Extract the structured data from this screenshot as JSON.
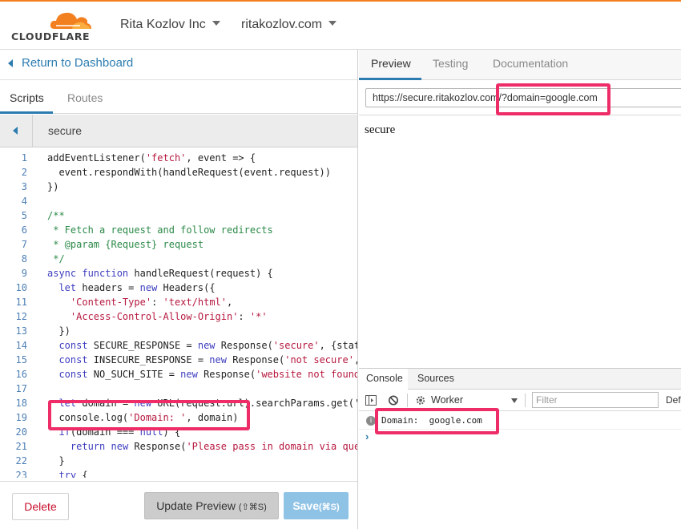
{
  "header": {
    "logo_text": "CLOUDFLARE",
    "account": "Rita Kozlov Inc",
    "domain": "ritakozlov.com",
    "accent_color": "#f38020"
  },
  "left": {
    "return_label": "Return to Dashboard",
    "tabs": [
      {
        "label": "Scripts",
        "active": true
      },
      {
        "label": "Routes",
        "active": false
      }
    ],
    "script_name": "secure",
    "footer": {
      "delete_label": "Delete",
      "update_label": "Update Preview",
      "update_shortcut": "(⇧⌘S)",
      "save_label": "Save",
      "save_shortcut": "(⌘S)"
    }
  },
  "code_lines": [
    {
      "n": "1",
      "html": "addEventListener(<span class=\"str\">'fetch'</span>, event => {"
    },
    {
      "n": "2",
      "html": "  event.respondWith(handleRequest(event.request))"
    },
    {
      "n": "3",
      "html": "})"
    },
    {
      "n": "4",
      "html": ""
    },
    {
      "n": "5",
      "html": "<span class=\"cm\">/**</span>"
    },
    {
      "n": "6",
      "html": "<span class=\"cm\"> * Fetch a request and follow redirects</span>"
    },
    {
      "n": "7",
      "html": "<span class=\"cm\"> * @param {Request} request</span>"
    },
    {
      "n": "8",
      "html": "<span class=\"cm\"> */</span>"
    },
    {
      "n": "9",
      "html": "<span class=\"kw\">async</span> <span class=\"kw\">function</span> handleRequest(request) {"
    },
    {
      "n": "10",
      "html": "  <span class=\"kw\">let</span> headers = <span class=\"kw\">new</span> Headers({"
    },
    {
      "n": "11",
      "html": "    <span class=\"str\">'Content-Type'</span>: <span class=\"str\">'text/html'</span>,"
    },
    {
      "n": "12",
      "html": "    <span class=\"str\">'Access-Control-Allow-Origin'</span>: <span class=\"str\">'*'</span>"
    },
    {
      "n": "13",
      "html": "  })"
    },
    {
      "n": "14",
      "html": "  <span class=\"kw\">const</span> SECURE_RESPONSE = <span class=\"kw\">new</span> Response(<span class=\"str\">'secure'</span>, {stat"
    },
    {
      "n": "15",
      "html": "  <span class=\"kw\">const</span> INSECURE_RESPONSE = <span class=\"kw\">new</span> Response(<span class=\"str\">'not secure'</span>,"
    },
    {
      "n": "16",
      "html": "  <span class=\"kw\">const</span> NO_SUCH_SITE = <span class=\"kw\">new</span> Response(<span class=\"str\">'website not found</span>"
    },
    {
      "n": "17",
      "html": ""
    },
    {
      "n": "18",
      "html": "  <span class=\"kw\">let</span> domain = <span class=\"kw\">new</span> URL(request.url).searchParams.get('"
    },
    {
      "n": "19",
      "html": "  console.log(<span class=\"str\">'Domain: '</span>, domain)"
    },
    {
      "n": "20",
      "html": "  <span class=\"kw\">if</span>(domain === <span class=\"kw\">null</span>) {"
    },
    {
      "n": "21",
      "html": "    <span class=\"kw\">return</span> <span class=\"kw\">new</span> Response(<span class=\"str\">'Please pass in domain via que</span>"
    },
    {
      "n": "22",
      "html": "  }"
    },
    {
      "n": "23",
      "html": "  <span class=\"kw\">try</span> {"
    }
  ],
  "right": {
    "tabs": [
      {
        "label": "Preview",
        "active": true
      },
      {
        "label": "Testing",
        "active": false
      },
      {
        "label": "Documentation",
        "active": false
      }
    ],
    "url": "https://secure.ritakozlov.com/?domain=google.com",
    "preview_text": "secure",
    "devtools": {
      "tabs": [
        {
          "label": "Console",
          "active": true
        },
        {
          "label": "Sources",
          "active": false
        }
      ],
      "context": "Worker",
      "filter_placeholder": "Filter",
      "levels_label": "Def",
      "log": "Domain:  google.com",
      "prompt": "›"
    }
  },
  "highlight_color": "#ee2d68"
}
